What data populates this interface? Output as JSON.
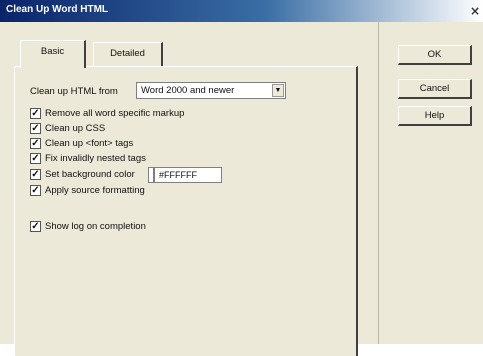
{
  "window": {
    "title": "Clean Up Word HTML",
    "close_symbol": "×"
  },
  "tabs": [
    {
      "label": "Basic",
      "active": true
    },
    {
      "label": "Detailed",
      "active": false
    }
  ],
  "basic": {
    "cleanup_from_label": "Clean up HTML from",
    "cleanup_from_value": "Word 2000 and newer",
    "options": [
      {
        "label": "Remove all word specific markup",
        "checked": true
      },
      {
        "label": "Clean up CSS",
        "checked": true
      },
      {
        "label": "Clean up <font> tags",
        "checked": true
      },
      {
        "label": "Fix invalidly nested tags",
        "checked": true
      },
      {
        "label": "Set background color",
        "checked": true
      },
      {
        "label": "Apply source formatting",
        "checked": true
      }
    ],
    "background_color_value": "#FFFFFF",
    "show_log": {
      "label": "Show log on completion",
      "checked": true
    }
  },
  "buttons": {
    "ok": "OK",
    "cancel": "Cancel",
    "help": "Help"
  }
}
